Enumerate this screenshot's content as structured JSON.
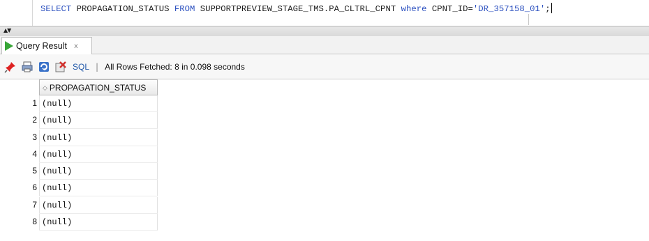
{
  "editor": {
    "sql_select": "SELECT",
    "sql_columns": " PROPAGATION_STATUS ",
    "sql_from": "FROM",
    "sql_table": " SUPPORTPREVIEW_STAGE_TMS.PA_CLTRL_CPNT ",
    "sql_where": "where",
    "sql_condition": " CPNT_ID=",
    "sql_literal": "'DR_357158_01'",
    "sql_end": ";"
  },
  "tab": {
    "label": "Query Result",
    "close": "x"
  },
  "toolbar": {
    "sql_link": "SQL",
    "separator": "|",
    "status": "All Rows Fetched: 8 in 0.098 seconds"
  },
  "grid": {
    "column_header": "PROPAGATION_STATUS",
    "rows": [
      {
        "num": "1",
        "value": "(null)"
      },
      {
        "num": "2",
        "value": "(null)"
      },
      {
        "num": "3",
        "value": "(null)"
      },
      {
        "num": "4",
        "value": "(null)"
      },
      {
        "num": "5",
        "value": "(null)"
      },
      {
        "num": "6",
        "value": "(null)"
      },
      {
        "num": "7",
        "value": "(null)"
      },
      {
        "num": "8",
        "value": "(null)"
      }
    ]
  },
  "colors": {
    "keyword": "#2a4fbf",
    "run_icon": "#37a537",
    "link": "#1e56a8"
  },
  "icons": [
    "run-icon",
    "pin-icon",
    "print-icon",
    "refresh-icon",
    "export-icon",
    "sort-icon"
  ]
}
